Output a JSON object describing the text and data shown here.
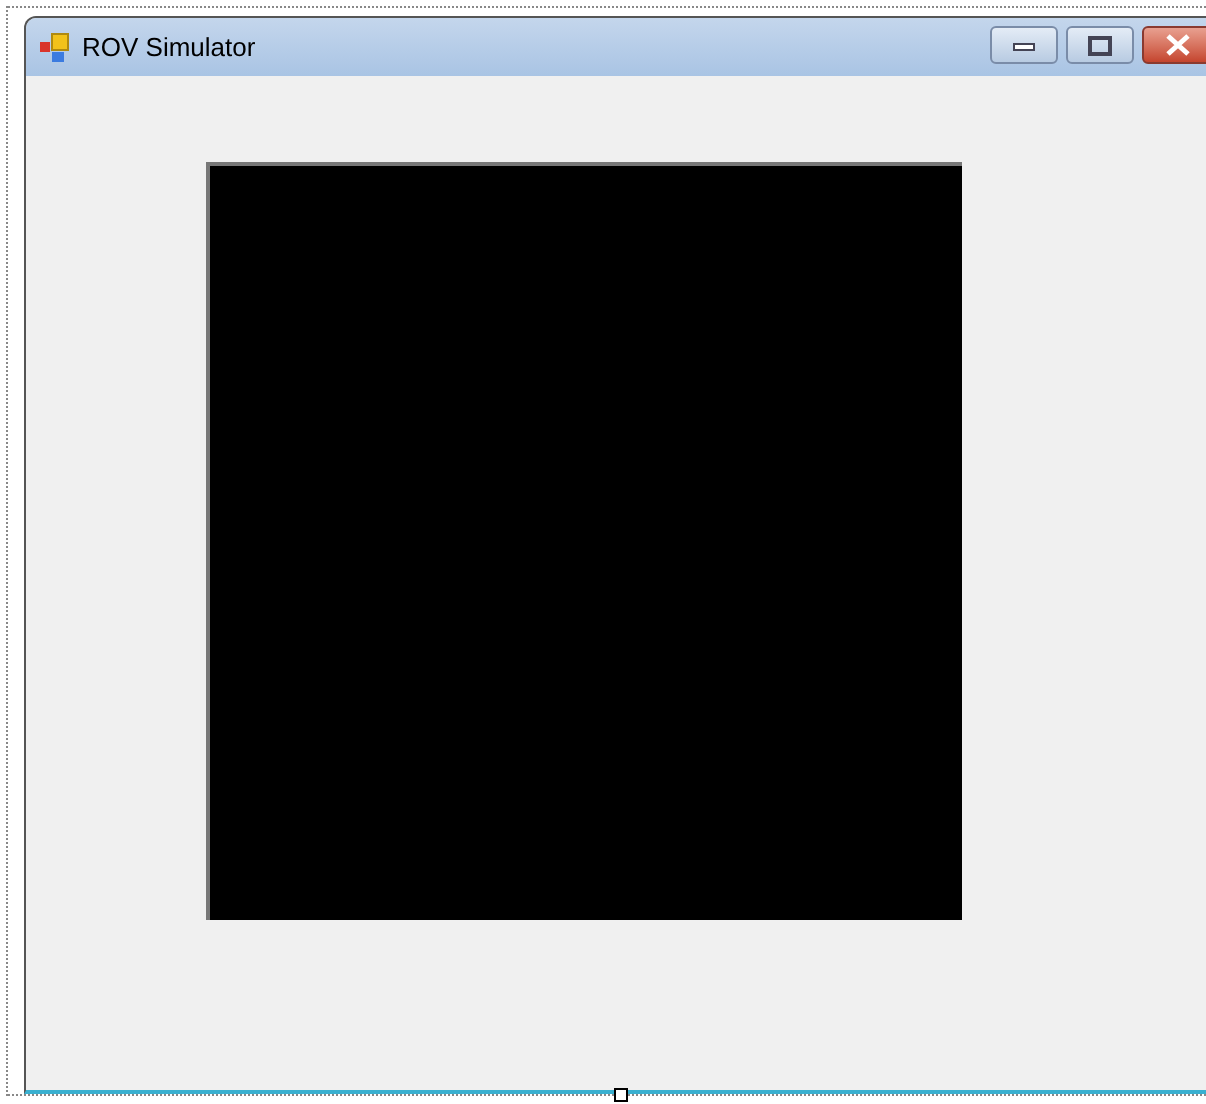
{
  "window": {
    "title": "ROV Simulator"
  }
}
